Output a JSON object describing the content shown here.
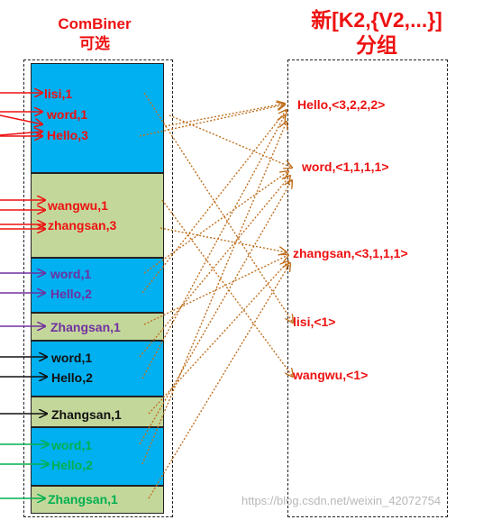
{
  "combiner": {
    "title_line1": "ComBiner",
    "title_line2": "可选",
    "blocks": [
      {
        "color": "blue",
        "items": [
          "lisi,1",
          "word,1",
          "Hello,3"
        ],
        "text_color": "red"
      },
      {
        "color": "green",
        "items": [
          "wangwu,1",
          "zhangsan,3"
        ],
        "text_color": "red"
      },
      {
        "color": "blue",
        "items": [
          "word,1",
          "Hello,2"
        ],
        "text_color": "purple"
      },
      {
        "color": "green",
        "items": [
          "Zhangsan,1"
        ],
        "text_color": "purple"
      },
      {
        "color": "blue",
        "items": [
          "word,1",
          "Hello,2"
        ],
        "text_color": "black"
      },
      {
        "color": "green",
        "items": [
          "Zhangsan,1"
        ],
        "text_color": "black"
      },
      {
        "color": "blue",
        "items": [
          "word,1",
          "Hello,2"
        ],
        "text_color": "green"
      },
      {
        "color": "green",
        "items": [
          "Zhangsan,1"
        ],
        "text_color": "green"
      }
    ]
  },
  "group": {
    "title_line1": "新[K2,{V2,...}]",
    "title_line2": "分组",
    "items": [
      "Hello,<3,2,2,2>",
      "word,<1,1,1,1>",
      "zhangsan,<3,1,1,1>",
      "lisi,<1>",
      "wangwu,<1>"
    ]
  },
  "watermark": "https://blog.csdn.net/weixin_42072754",
  "colors": {
    "red": "#ee1111",
    "purple": "#7030a0",
    "black": "#111111",
    "green": "#00b050",
    "blue_block": "#00b0f0",
    "green_block": "#c4d79b",
    "dotted_arrow": "#c07020"
  }
}
